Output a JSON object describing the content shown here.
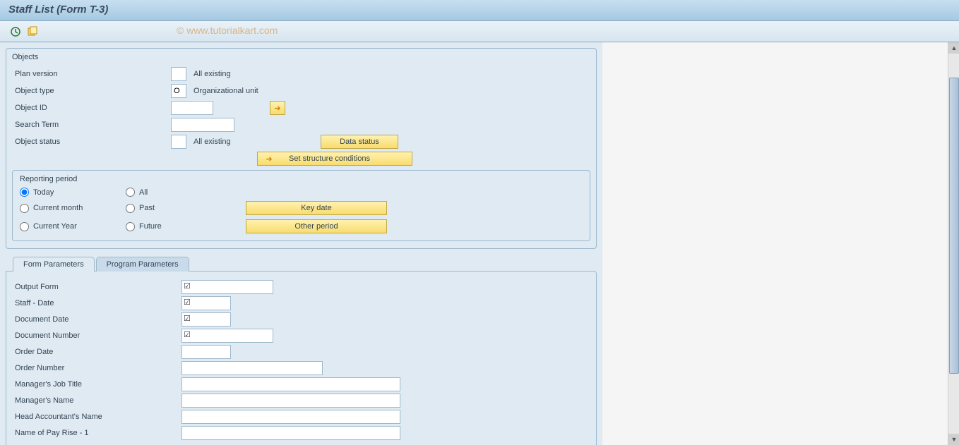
{
  "title": "Staff List (Form T-3)",
  "watermark": "© www.tutorialkart.com",
  "objects": {
    "group_title": "Objects",
    "plan_version_label": "Plan version",
    "plan_version_value": "",
    "plan_version_text": "All existing",
    "object_type_label": "Object type",
    "object_type_value": "O",
    "object_type_text": "Organizational unit",
    "object_id_label": "Object ID",
    "object_id_value": "",
    "search_term_label": "Search Term",
    "search_term_value": "",
    "object_status_label": "Object status",
    "object_status_value": "",
    "object_status_text": "All existing",
    "data_status_btn": "Data status",
    "set_structure_btn": "Set structure conditions"
  },
  "reporting_period": {
    "group_title": "Reporting period",
    "today": "Today",
    "all": "All",
    "current_month": "Current month",
    "past": "Past",
    "current_year": "Current Year",
    "future": "Future",
    "key_date_btn": "Key date",
    "other_period_btn": "Other period"
  },
  "tabs": {
    "form_params": "Form Parameters",
    "program_params": "Program Parameters"
  },
  "form_params": {
    "output_form_label": "Output Form",
    "output_form_value": "",
    "staff_date_label": "Staff - Date",
    "staff_date_value": "",
    "document_date_label": "Document Date",
    "document_date_value": "",
    "document_number_label": "Document Number",
    "document_number_value": "",
    "order_date_label": "Order Date",
    "order_date_value": "",
    "order_number_label": "Order Number",
    "order_number_value": "",
    "manager_job_title_label": "Manager's Job Title",
    "manager_job_title_value": "",
    "manager_name_label": "Manager's Name",
    "manager_name_value": "",
    "head_accountant_label": "Head Accountant's Name",
    "head_accountant_value": "",
    "pay_rise_1_label": "Name of Pay Rise - 1",
    "pay_rise_1_value": ""
  }
}
